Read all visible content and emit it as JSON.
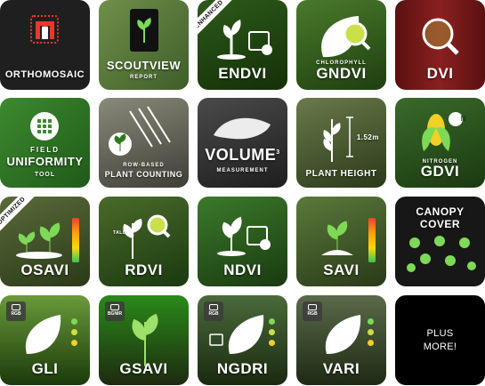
{
  "tiles": [
    {
      "title": "ORTHOMOSAIC"
    },
    {
      "title": "SCOUTVIEW",
      "subtitle": "REPORT"
    },
    {
      "title": "ENDVI",
      "ribbon": "ENHANCED"
    },
    {
      "title": "GNDVI",
      "subtitle": "CHLOROPHYLL"
    },
    {
      "title": "DVI"
    },
    {
      "title": "UNIFORMITY",
      "pre": "FIELD",
      "subtitle": "TOOL"
    },
    {
      "title": "PLANT COUNTING",
      "pre": "ROW-BASED"
    },
    {
      "title": "VOLUME",
      "sup": "3",
      "subtitle": "MEASUREMENT"
    },
    {
      "title": "PLANT HEIGHT",
      "measure": "1.52m"
    },
    {
      "title": "GDVI",
      "subtitle": "NITROGEN",
      "n": "N"
    },
    {
      "title": "OSAVI",
      "ribbon": "OPTIMIZED"
    },
    {
      "title": "RDVI",
      "tall": "TALL"
    },
    {
      "title": "NDVI"
    },
    {
      "title": "SAVI"
    },
    {
      "title": "CANOPY",
      "title2": "COVER"
    },
    {
      "title": "GLI",
      "badge": "RGB"
    },
    {
      "title": "GSAVI",
      "badge": "BGNIR"
    },
    {
      "title": "NGDRI",
      "badge": "RGB"
    },
    {
      "title": "VARI",
      "badge": "RGB"
    },
    {
      "title": "PLUS",
      "title2": "MORE!"
    }
  ],
  "colors": {
    "accent_green": "#7ed957",
    "meter_top": "#ff3b30",
    "meter_bottom": "#34c759",
    "badge_yellow": "#f2d024"
  }
}
